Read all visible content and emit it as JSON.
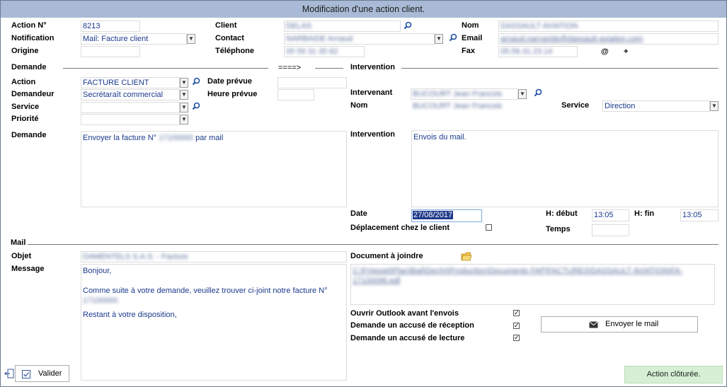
{
  "window": {
    "title": "Modification d'une action client."
  },
  "header": {
    "action_no_label": "Action N°",
    "action_no": "8213",
    "notification_label": "Notification",
    "notification": "Mail: Facture client",
    "origine_label": "Origine",
    "origine": "",
    "client_label": "Client",
    "client": "DELAS",
    "contact_label": "Contact",
    "contact": "NARBAIDE Arnaud",
    "telephone_label": "Téléphone",
    "telephone": "05 59 31 35 62",
    "nom_label": "Nom",
    "nom": "DASSAULT AVIATION",
    "email_label": "Email",
    "email": "arnaud.narnaride@dassault-aviation.com",
    "fax_label": "Fax",
    "fax": "05.59.31.23.14",
    "at_sign": "@",
    "plus_sign": "+"
  },
  "demande": {
    "section_label": "Demande",
    "arrow": "====>",
    "action_label": "Action",
    "action": "FACTURE CLIENT",
    "demandeur_label": "Demandeur",
    "demandeur": "Secrétaraît commercial",
    "service_label": "Service",
    "service": "",
    "priorite_label": "Priorité",
    "priorite": "",
    "date_prevue_label": "Date prévue",
    "date_prevue": "",
    "heure_prevue_label": "Heure prévue",
    "heure_prevue": "",
    "demande_label": "Demande",
    "demande_prefix": "Envoyer la facture N°",
    "demande_number": "17100000",
    "demande_suffix": "par mail"
  },
  "intervention": {
    "section_label": "Intervention",
    "intervenant_label": "Intervenant",
    "intervenant": "BUCOURT Jean Francois",
    "nom_label": "Nom",
    "nom": "BUCOURT Jean Francois",
    "service_label": "Service",
    "service": "Direction",
    "intervention_label": "Intervention",
    "intervention": "Envois du mail.",
    "date_label": "Date",
    "date": "27/08/2017",
    "h_debut_label": "H: début",
    "h_debut": "13:05",
    "h_fin_label": "H: fin",
    "h_fin": "13:05",
    "deplacement_label": "Déplacement chez le client",
    "temps_label": "Temps",
    "temps": ""
  },
  "mail": {
    "section_label": "Mail",
    "objet_label": "Objet",
    "objet": "DAMENTELS S.A.S. - Facture",
    "message_label": "Message",
    "message_line1": "Bonjour,",
    "message_line2": "Comme suite à votre demande, veuillez trouver ci-joint notre facture N°",
    "message_line3": "17100000.",
    "message_line4": "Restant à votre disposition,",
    "document_label": "Document à joindre",
    "document_path": "C:\\Frigoset\\Plan\\Bail\\Dev\\H\\Production\\Documents FAP\\FACTURES\\DASSAULT AVIATION\\FA-17100096.pdf",
    "outlook_label": "Ouvrir Outlook avant l'envois",
    "outlook_checked": true,
    "accuse_reception_label": "Demande un accusé de réception",
    "accuse_reception_checked": true,
    "accuse_lecture_label": "Demande un accusé de lecture",
    "accuse_lecture_checked": true,
    "send_button": "Envoyer le mail"
  },
  "footer": {
    "validate_button": "Valider",
    "status": "Action clôturée."
  },
  "icons": {
    "magnifier": "magnifier-icon",
    "dropdown": "chevron-down-icon",
    "folder": "folder-icon",
    "envelope": "envelope-icon",
    "check": "check-icon",
    "exit": "exit-icon"
  },
  "colors": {
    "titlebar": "#a9bad6",
    "value_text": "#1a3a8c",
    "status_bg": "#d5f0d5",
    "date_highlight": "#1f3a8a"
  }
}
